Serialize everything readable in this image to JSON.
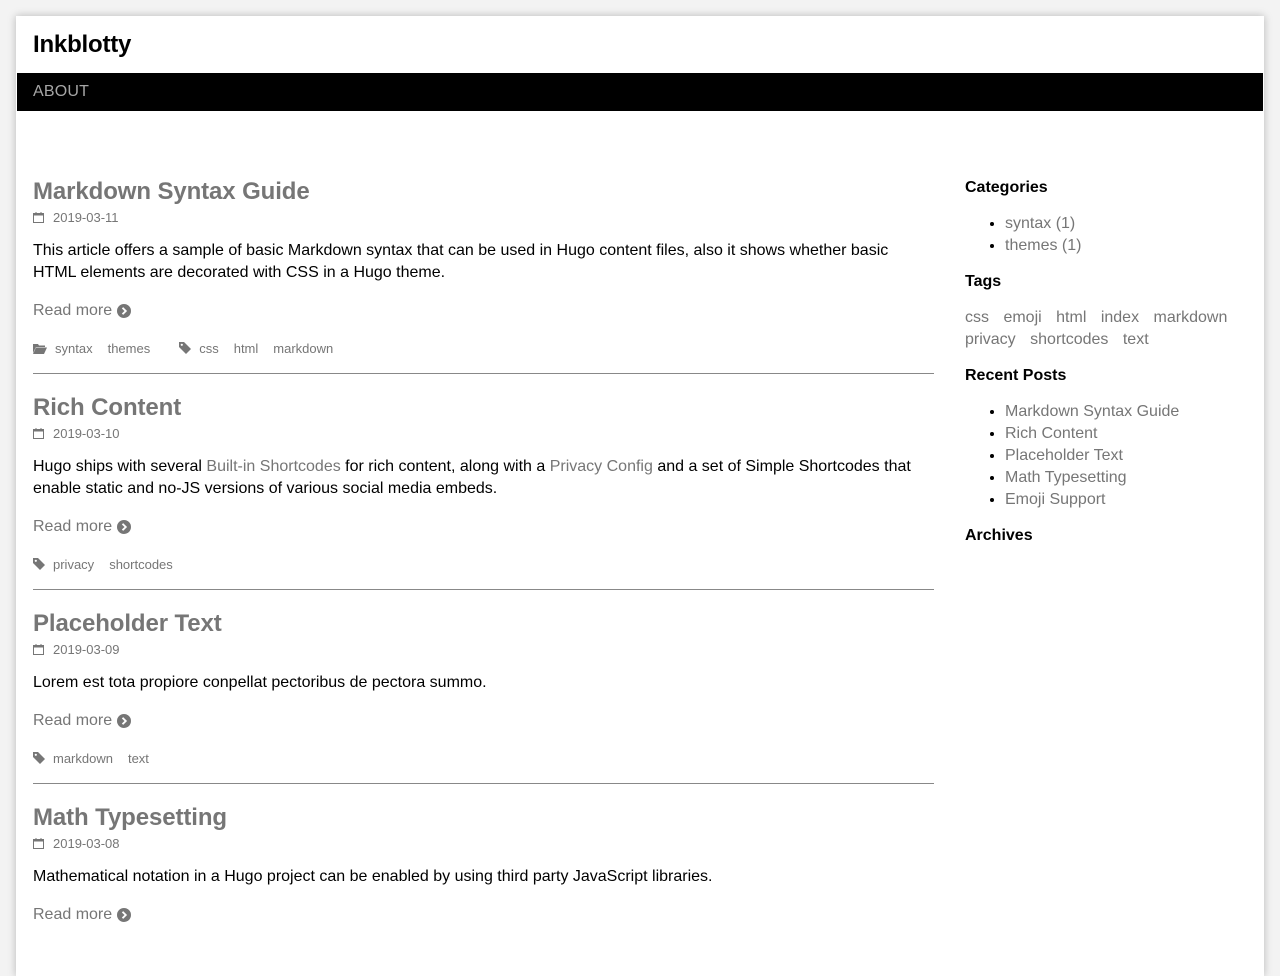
{
  "site": {
    "title": "Inkblotty"
  },
  "nav": {
    "items": [
      {
        "label": "ABOUT"
      }
    ]
  },
  "posts": [
    {
      "title": "Markdown Syntax Guide",
      "date": "2019-03-11",
      "summary": "This article offers a sample of basic Markdown syntax that can be used in Hugo content files, also it shows whether basic HTML elements are decorated with CSS in a Hugo theme.",
      "read_more": "Read more",
      "categories": [
        "syntax",
        "themes"
      ],
      "tags": [
        "css",
        "html",
        "markdown"
      ]
    },
    {
      "title": "Rich Content",
      "date": "2019-03-10",
      "summary_parts": {
        "p1": "Hugo ships with several ",
        "link1": "Built-in Shortcodes",
        "p2": " for rich content, along with a ",
        "link2": "Privacy Config",
        "p3": " and a set of Simple Shortcodes that enable static and no-JS versions of various social media embeds."
      },
      "read_more": "Read more",
      "tags": [
        "privacy",
        "shortcodes"
      ]
    },
    {
      "title": "Placeholder Text",
      "date": "2019-03-09",
      "summary": "Lorem est tota propiore conpellat pectoribus de pectora summo.",
      "read_more": "Read more",
      "tags": [
        "markdown",
        "text"
      ]
    },
    {
      "title": "Math Typesetting",
      "date": "2019-03-08",
      "summary": "Mathematical notation in a Hugo project can be enabled by using third party JavaScript libraries.",
      "read_more": "Read more"
    }
  ],
  "sidebar": {
    "categories": {
      "heading": "Categories",
      "items": [
        {
          "label": "syntax (1)"
        },
        {
          "label": "themes (1)"
        }
      ]
    },
    "tags": {
      "heading": "Tags",
      "items": [
        "css",
        "emoji",
        "html",
        "index",
        "markdown",
        "privacy",
        "shortcodes",
        "text"
      ]
    },
    "recent_posts": {
      "heading": "Recent Posts",
      "items": [
        "Markdown Syntax Guide",
        "Rich Content",
        "Placeholder Text",
        "Math Typesetting",
        "Emoji Support"
      ]
    },
    "archives": {
      "heading": "Archives"
    }
  },
  "colors": {
    "link": "#767676",
    "nav_bg": "#000000",
    "nav_text": "#a6a6a6",
    "divider": "#888888"
  },
  "icons": {
    "date": "calendar-icon",
    "read_more": "chevron-circle-right-icon",
    "categories": "folder-open-icon",
    "tags": "tag-icon"
  }
}
